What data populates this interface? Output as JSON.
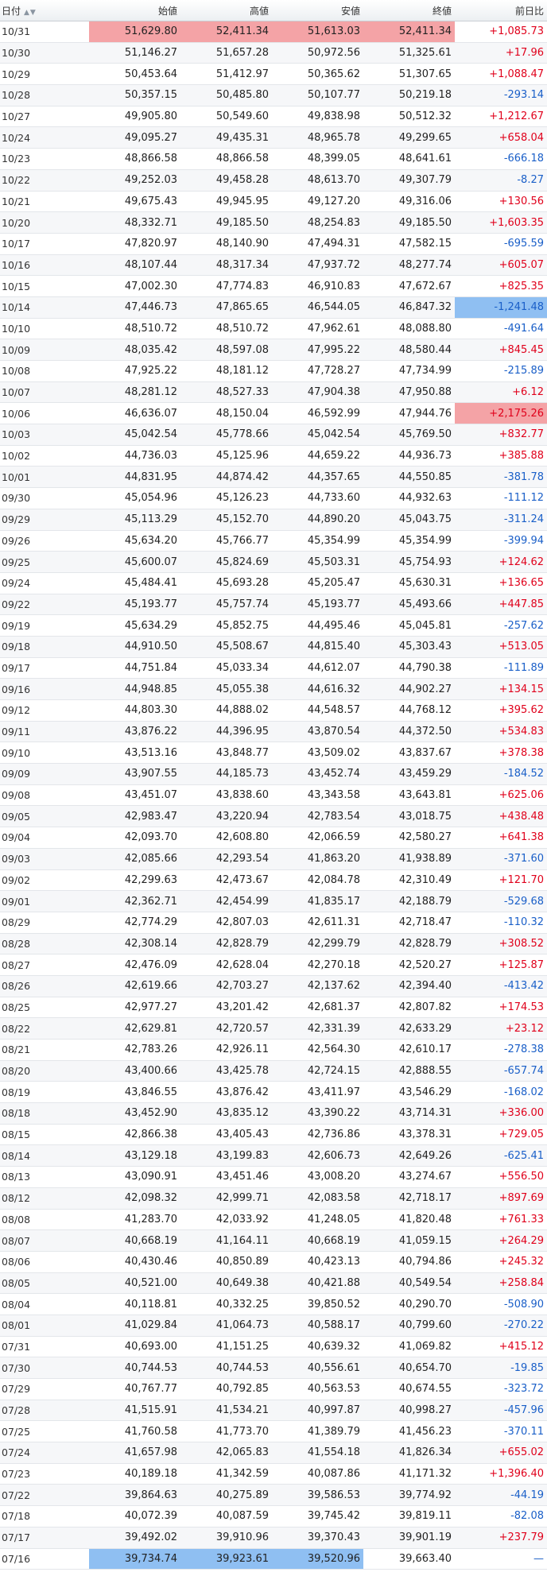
{
  "header": {
    "date": "日付",
    "open": "始値",
    "high": "高値",
    "low": "安値",
    "close": "終値",
    "change": "前日比",
    "sort_icon": "sort-arrows-icon"
  },
  "colors": {
    "up": "#e0001b",
    "down": "#1a5fc8",
    "highlight_high": "#f4a3a6",
    "highlight_low": "#8fbff2"
  },
  "rows": [
    [
      "10/31",
      "51,629.80",
      "52,411.34",
      "51,613.03",
      "52,411.34",
      "+1,085.73"
    ],
    [
      "10/30",
      "51,146.27",
      "51,657.28",
      "50,972.56",
      "51,325.61",
      "+17.96"
    ],
    [
      "10/29",
      "50,453.64",
      "51,412.97",
      "50,365.62",
      "51,307.65",
      "+1,088.47"
    ],
    [
      "10/28",
      "50,357.15",
      "50,485.80",
      "50,107.77",
      "50,219.18",
      "-293.14"
    ],
    [
      "10/27",
      "49,905.80",
      "50,549.60",
      "49,838.98",
      "50,512.32",
      "+1,212.67"
    ],
    [
      "10/24",
      "49,095.27",
      "49,435.31",
      "48,965.78",
      "49,299.65",
      "+658.04"
    ],
    [
      "10/23",
      "48,866.58",
      "48,866.58",
      "48,399.05",
      "48,641.61",
      "-666.18"
    ],
    [
      "10/22",
      "49,252.03",
      "49,458.28",
      "48,613.70",
      "49,307.79",
      "-8.27"
    ],
    [
      "10/21",
      "49,675.43",
      "49,945.95",
      "49,127.20",
      "49,316.06",
      "+130.56"
    ],
    [
      "10/20",
      "48,332.71",
      "49,185.50",
      "48,254.83",
      "49,185.50",
      "+1,603.35"
    ],
    [
      "10/17",
      "47,820.97",
      "48,140.90",
      "47,494.31",
      "47,582.15",
      "-695.59"
    ],
    [
      "10/16",
      "48,107.44",
      "48,317.34",
      "47,937.72",
      "48,277.74",
      "+605.07"
    ],
    [
      "10/15",
      "47,002.30",
      "47,774.83",
      "46,910.83",
      "47,672.67",
      "+825.35"
    ],
    [
      "10/14",
      "47,446.73",
      "47,865.65",
      "46,544.05",
      "46,847.32",
      "-1,241.48"
    ],
    [
      "10/10",
      "48,510.72",
      "48,510.72",
      "47,962.61",
      "48,088.80",
      "-491.64"
    ],
    [
      "10/09",
      "48,035.42",
      "48,597.08",
      "47,995.22",
      "48,580.44",
      "+845.45"
    ],
    [
      "10/08",
      "47,925.22",
      "48,181.12",
      "47,728.27",
      "47,734.99",
      "-215.89"
    ],
    [
      "10/07",
      "48,281.12",
      "48,527.33",
      "47,904.38",
      "47,950.88",
      "+6.12"
    ],
    [
      "10/06",
      "46,636.07",
      "48,150.04",
      "46,592.99",
      "47,944.76",
      "+2,175.26"
    ],
    [
      "10/03",
      "45,042.54",
      "45,778.66",
      "45,042.54",
      "45,769.50",
      "+832.77"
    ],
    [
      "10/02",
      "44,736.03",
      "45,125.96",
      "44,659.22",
      "44,936.73",
      "+385.88"
    ],
    [
      "10/01",
      "44,831.95",
      "44,874.42",
      "44,357.65",
      "44,550.85",
      "-381.78"
    ],
    [
      "09/30",
      "45,054.96",
      "45,126.23",
      "44,733.60",
      "44,932.63",
      "-111.12"
    ],
    [
      "09/29",
      "45,113.29",
      "45,152.70",
      "44,890.20",
      "45,043.75",
      "-311.24"
    ],
    [
      "09/26",
      "45,634.20",
      "45,766.77",
      "45,354.99",
      "45,354.99",
      "-399.94"
    ],
    [
      "09/25",
      "45,600.07",
      "45,824.69",
      "45,503.31",
      "45,754.93",
      "+124.62"
    ],
    [
      "09/24",
      "45,484.41",
      "45,693.28",
      "45,205.47",
      "45,630.31",
      "+136.65"
    ],
    [
      "09/22",
      "45,193.77",
      "45,757.74",
      "45,193.77",
      "45,493.66",
      "+447.85"
    ],
    [
      "09/19",
      "45,634.29",
      "45,852.75",
      "44,495.46",
      "45,045.81",
      "-257.62"
    ],
    [
      "09/18",
      "44,910.50",
      "45,508.67",
      "44,815.40",
      "45,303.43",
      "+513.05"
    ],
    [
      "09/17",
      "44,751.84",
      "45,033.34",
      "44,612.07",
      "44,790.38",
      "-111.89"
    ],
    [
      "09/16",
      "44,948.85",
      "45,055.38",
      "44,616.32",
      "44,902.27",
      "+134.15"
    ],
    [
      "09/12",
      "44,803.30",
      "44,888.02",
      "44,548.57",
      "44,768.12",
      "+395.62"
    ],
    [
      "09/11",
      "43,876.22",
      "44,396.95",
      "43,870.54",
      "44,372.50",
      "+534.83"
    ],
    [
      "09/10",
      "43,513.16",
      "43,848.77",
      "43,509.02",
      "43,837.67",
      "+378.38"
    ],
    [
      "09/09",
      "43,907.55",
      "44,185.73",
      "43,452.74",
      "43,459.29",
      "-184.52"
    ],
    [
      "09/08",
      "43,451.07",
      "43,838.60",
      "43,343.58",
      "43,643.81",
      "+625.06"
    ],
    [
      "09/05",
      "42,983.47",
      "43,220.94",
      "42,783.54",
      "43,018.75",
      "+438.48"
    ],
    [
      "09/04",
      "42,093.70",
      "42,608.80",
      "42,066.59",
      "42,580.27",
      "+641.38"
    ],
    [
      "09/03",
      "42,085.66",
      "42,293.54",
      "41,863.20",
      "41,938.89",
      "-371.60"
    ],
    [
      "09/02",
      "42,299.63",
      "42,473.67",
      "42,084.78",
      "42,310.49",
      "+121.70"
    ],
    [
      "09/01",
      "42,362.71",
      "42,454.99",
      "41,835.17",
      "42,188.79",
      "-529.68"
    ],
    [
      "08/29",
      "42,774.29",
      "42,807.03",
      "42,611.31",
      "42,718.47",
      "-110.32"
    ],
    [
      "08/28",
      "42,308.14",
      "42,828.79",
      "42,299.79",
      "42,828.79",
      "+308.52"
    ],
    [
      "08/27",
      "42,476.09",
      "42,628.04",
      "42,270.18",
      "42,520.27",
      "+125.87"
    ],
    [
      "08/26",
      "42,619.66",
      "42,703.27",
      "42,137.62",
      "42,394.40",
      "-413.42"
    ],
    [
      "08/25",
      "42,977.27",
      "43,201.42",
      "42,681.37",
      "42,807.82",
      "+174.53"
    ],
    [
      "08/22",
      "42,629.81",
      "42,720.57",
      "42,331.39",
      "42,633.29",
      "+23.12"
    ],
    [
      "08/21",
      "42,783.26",
      "42,926.11",
      "42,564.30",
      "42,610.17",
      "-278.38"
    ],
    [
      "08/20",
      "43,400.66",
      "43,425.78",
      "42,724.15",
      "42,888.55",
      "-657.74"
    ],
    [
      "08/19",
      "43,846.55",
      "43,876.42",
      "43,411.97",
      "43,546.29",
      "-168.02"
    ],
    [
      "08/18",
      "43,452.90",
      "43,835.12",
      "43,390.22",
      "43,714.31",
      "+336.00"
    ],
    [
      "08/15",
      "42,866.38",
      "43,405.43",
      "42,736.86",
      "43,378.31",
      "+729.05"
    ],
    [
      "08/14",
      "43,129.18",
      "43,199.83",
      "42,606.73",
      "42,649.26",
      "-625.41"
    ],
    [
      "08/13",
      "43,090.91",
      "43,451.46",
      "43,008.20",
      "43,274.67",
      "+556.50"
    ],
    [
      "08/12",
      "42,098.32",
      "42,999.71",
      "42,083.58",
      "42,718.17",
      "+897.69"
    ],
    [
      "08/08",
      "41,283.70",
      "42,033.92",
      "41,248.05",
      "41,820.48",
      "+761.33"
    ],
    [
      "08/07",
      "40,668.19",
      "41,164.11",
      "40,668.19",
      "41,059.15",
      "+264.29"
    ],
    [
      "08/06",
      "40,430.46",
      "40,850.89",
      "40,423.13",
      "40,794.86",
      "+245.32"
    ],
    [
      "08/05",
      "40,521.00",
      "40,649.38",
      "40,421.88",
      "40,549.54",
      "+258.84"
    ],
    [
      "08/04",
      "40,118.81",
      "40,332.25",
      "39,850.52",
      "40,290.70",
      "-508.90"
    ],
    [
      "08/01",
      "41,029.84",
      "41,064.73",
      "40,588.17",
      "40,799.60",
      "-270.22"
    ],
    [
      "07/31",
      "40,693.00",
      "41,151.25",
      "40,639.32",
      "41,069.82",
      "+415.12"
    ],
    [
      "07/30",
      "40,744.53",
      "40,744.53",
      "40,556.61",
      "40,654.70",
      "-19.85"
    ],
    [
      "07/29",
      "40,767.77",
      "40,792.85",
      "40,563.53",
      "40,674.55",
      "-323.72"
    ],
    [
      "07/28",
      "41,515.91",
      "41,534.21",
      "40,997.87",
      "40,998.27",
      "-457.96"
    ],
    [
      "07/25",
      "41,760.58",
      "41,773.70",
      "41,389.79",
      "41,456.23",
      "-370.11"
    ],
    [
      "07/24",
      "41,657.98",
      "42,065.83",
      "41,554.18",
      "41,826.34",
      "+655.02"
    ],
    [
      "07/23",
      "40,189.18",
      "41,342.59",
      "40,087.86",
      "41,171.32",
      "+1,396.40"
    ],
    [
      "07/22",
      "39,864.63",
      "40,275.89",
      "39,586.53",
      "39,774.92",
      "-44.19"
    ],
    [
      "07/18",
      "40,072.39",
      "40,087.59",
      "39,745.42",
      "39,819.11",
      "-82.08"
    ],
    [
      "07/17",
      "39,492.02",
      "39,910.96",
      "39,370.43",
      "39,901.19",
      "+237.79"
    ],
    [
      "07/16",
      "39,734.74",
      "39,923.61",
      "39,520.96",
      "39,663.40",
      "—"
    ]
  ],
  "highlights": [
    {
      "row": 0,
      "col": 1,
      "kind": "high"
    },
    {
      "row": 0,
      "col": 2,
      "kind": "high"
    },
    {
      "row": 0,
      "col": 3,
      "kind": "high"
    },
    {
      "row": 0,
      "col": 4,
      "kind": "high"
    },
    {
      "row": 13,
      "col": 5,
      "kind": "low"
    },
    {
      "row": 18,
      "col": 5,
      "kind": "high"
    },
    {
      "row": 72,
      "col": 1,
      "kind": "low"
    },
    {
      "row": 72,
      "col": 2,
      "kind": "low"
    },
    {
      "row": 72,
      "col": 3,
      "kind": "low"
    },
    {
      "row": 73,
      "col": 4,
      "kind": "low"
    }
  ]
}
